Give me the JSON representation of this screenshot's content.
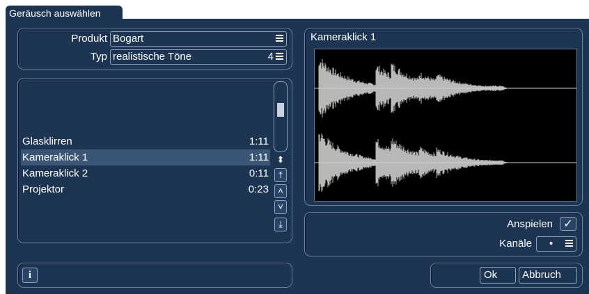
{
  "dialog": {
    "title": "Geräusch auswählen"
  },
  "filters": {
    "produkt_label": "Produkt",
    "produkt_value": "Bogart",
    "typ_label": "Typ",
    "typ_value": "realistische Töne",
    "typ_count": "4"
  },
  "list": {
    "items": [
      {
        "name": "Glasklirren",
        "duration": "1:11"
      },
      {
        "name": "Kameraklick 1",
        "duration": "1:11"
      },
      {
        "name": "Kameraklick 2",
        "duration": "0:11"
      },
      {
        "name": "Projektor",
        "duration": "0:23"
      }
    ],
    "selected_index": 1
  },
  "preview": {
    "title": "Kameraklick 1"
  },
  "options": {
    "anspielen_label": "Anspielen",
    "anspielen_checked": true,
    "kanaele_label": "Kanäle",
    "kanaele_value": "•"
  },
  "footer": {
    "info_label": "i",
    "ok_label": "Ok",
    "cancel_label": "Abbruch"
  },
  "icons": {
    "scroll_both": "⬍",
    "scroll_top": "⤒",
    "scroll_up": "˄",
    "scroll_down": "˅",
    "scroll_bottom": "⤓",
    "check": "✓",
    "menu": "≡"
  },
  "colors": {
    "background": "#1d3452",
    "waveform": "#b8b8b8",
    "border": "#6a83a5"
  }
}
